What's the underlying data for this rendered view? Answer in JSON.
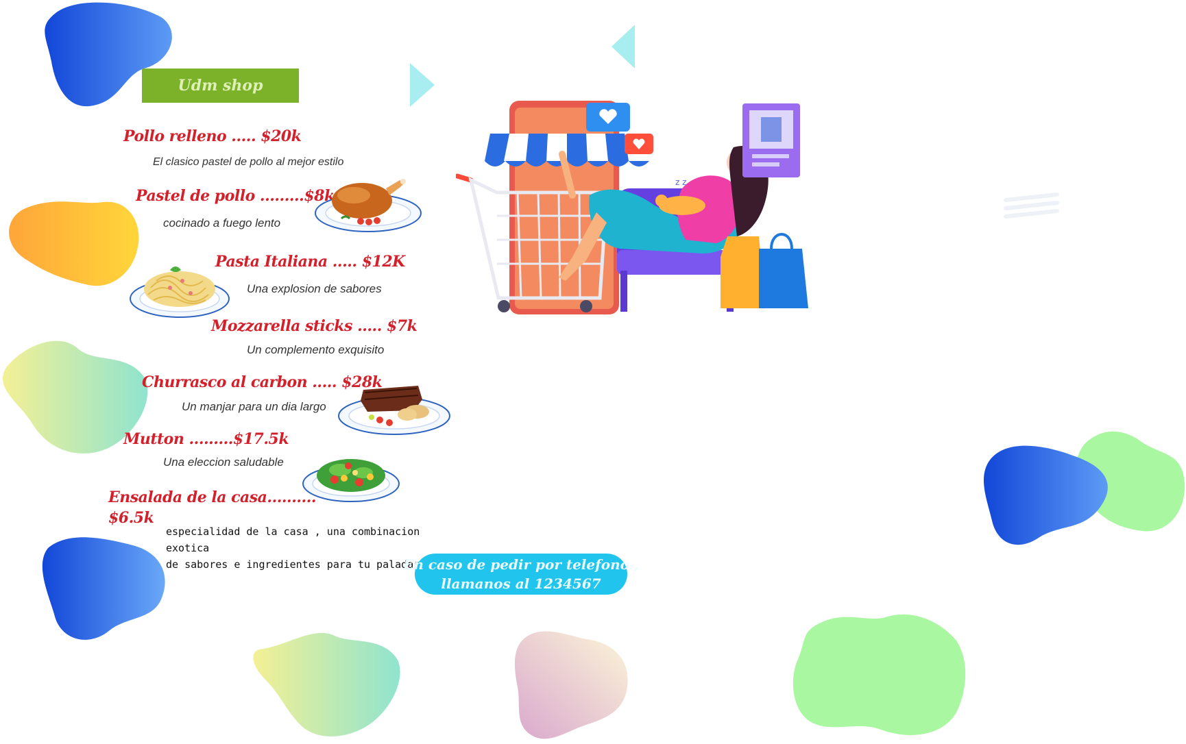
{
  "shop": {
    "name": "Udm shop"
  },
  "menu": {
    "items": [
      {
        "title": "Pollo relleno ..... $20k",
        "description": "El clasico pastel de pollo al mejor estilo"
      },
      {
        "title": "Pastel de pollo .........$8k",
        "description": "cocinado a fuego lento"
      },
      {
        "title": "Pasta Italiana ..... $12K",
        "description": "Una explosion de sabores"
      },
      {
        "title": "Mozzarella sticks ..... $7k",
        "description": "Un complemento exquisito"
      },
      {
        "title": "Churrasco al carbon ..... $28k",
        "description": "Un manjar para un dia largo"
      },
      {
        "title": "Mutton .........$17.5k",
        "description": "Una eleccion saludable"
      },
      {
        "title_line1": "Ensalada de la casa..........",
        "title_line2": "$6.5k",
        "description_line1": "especialidad de la casa , una combinacion",
        "description_line2": "exotica",
        "description_line3": "de sabores e ingredientes para tu paladar"
      }
    ]
  },
  "contact": {
    "line1": "En caso de pedir por telefono ,",
    "line2": "llamanos al 1234567"
  },
  "icons": [
    "roast-chicken-plate-icon",
    "spaghetti-plate-icon",
    "steak-plate-icon",
    "salad-plate-icon",
    "online-shopping-illustration",
    "play-triangle-icon"
  ],
  "colors": {
    "badge": "#7cb22a",
    "dish_title": "#d3212c",
    "pill": "#21c4ec"
  }
}
